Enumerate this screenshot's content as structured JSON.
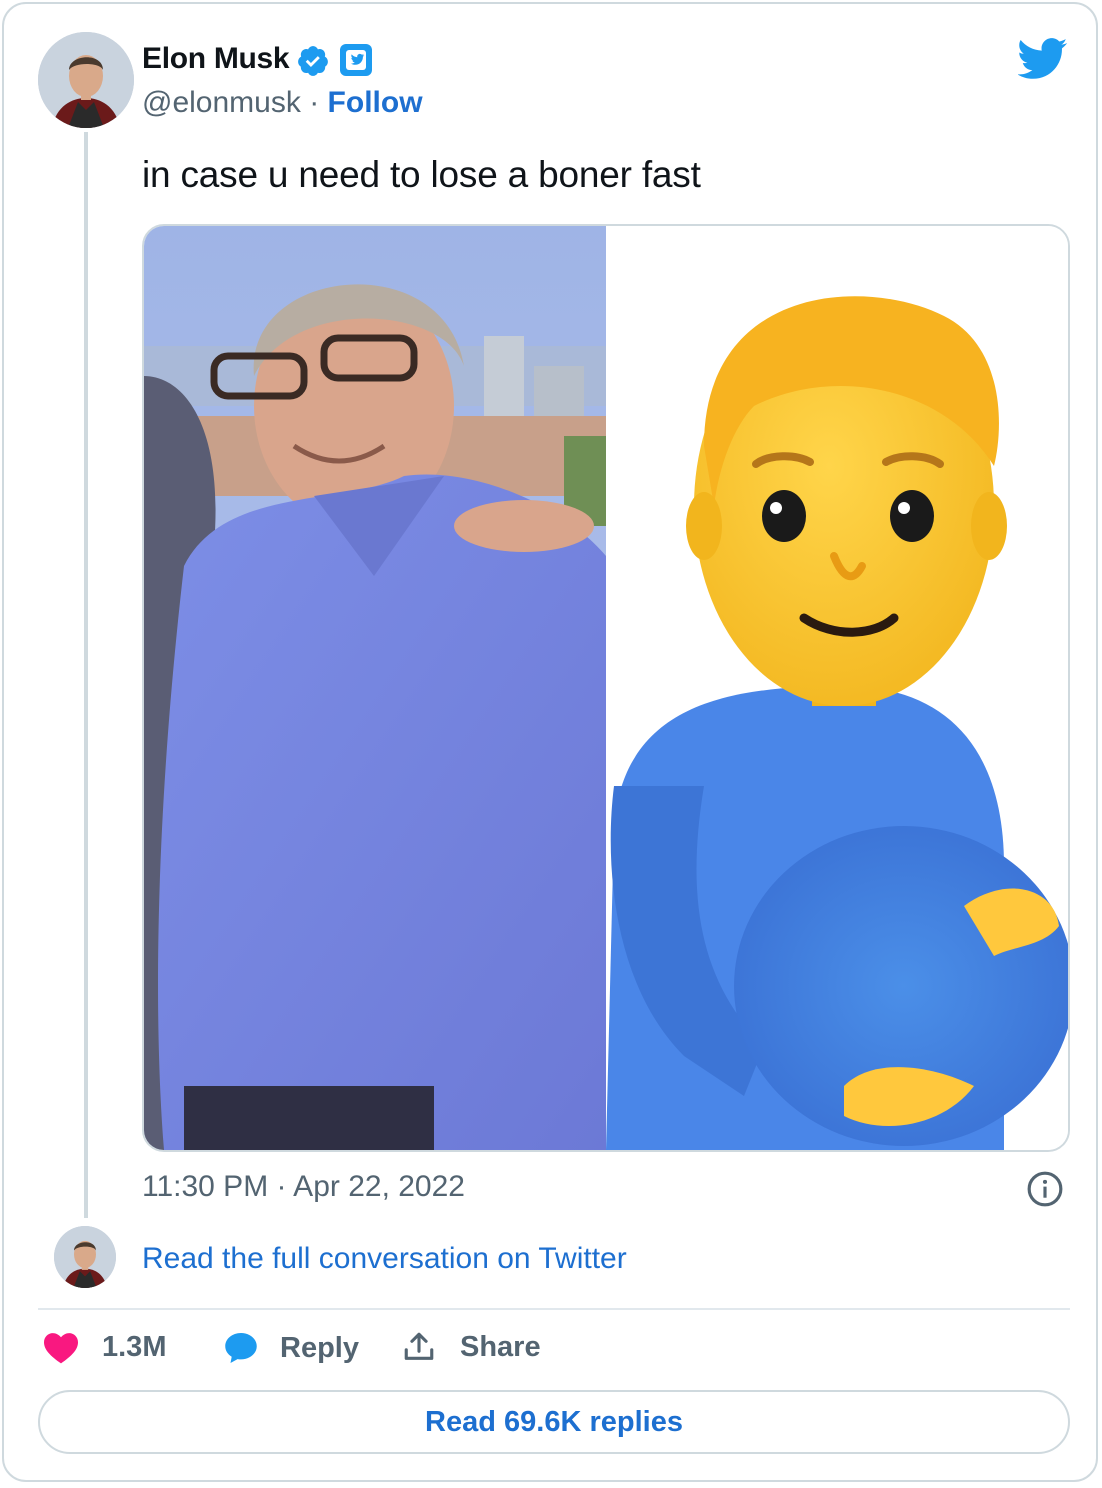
{
  "author": {
    "name": "Elon Musk",
    "handle": "@elonmusk",
    "separator": "·",
    "follow_label": "Follow",
    "avatar_alt": "avatar"
  },
  "tweet": {
    "text": "in case u need to lose a boner fast",
    "media_description": "two-panel meme image",
    "timestamp": "11:30 PM · Apr 22, 2022"
  },
  "conversation_link": "Read the full conversation on Twitter",
  "actions": {
    "likes": "1.3M",
    "reply_label": "Reply",
    "share_label": "Share"
  },
  "read_replies_label": "Read 69.6K replies",
  "colors": {
    "twitter_blue": "#1d9bf0",
    "link_blue": "#1d6fd0",
    "like_pink": "#f91880",
    "muted": "#536471",
    "border": "#cfd9de"
  },
  "icons": [
    "verified-badge-icon",
    "twitter-badge-icon",
    "twitter-bird-icon",
    "info-icon",
    "heart-icon",
    "reply-bubble-icon",
    "share-icon"
  ]
}
